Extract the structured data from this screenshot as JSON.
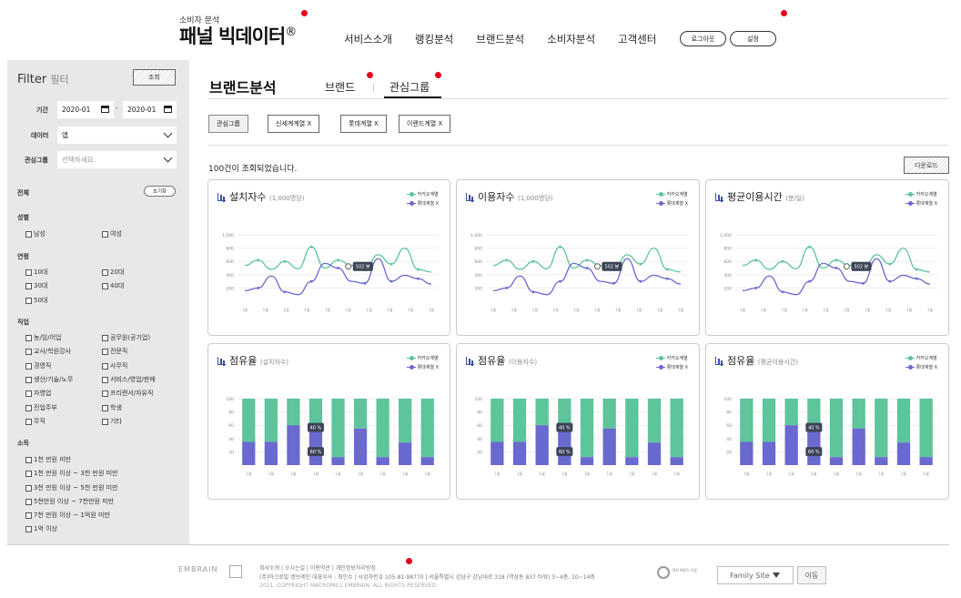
{
  "header": {
    "logo_sub": "소비자 분석",
    "logo_main": "패널 빅데이터",
    "logo_mark": "®",
    "nav": [
      "서비스소개",
      "랭킹분석",
      "브랜드분석",
      "소비자분석",
      "고객센터"
    ],
    "logout": "로그아웃",
    "settings": "설정"
  },
  "sidebar": {
    "title": "Filter",
    "title_sub": "필터",
    "query_btn": "조회",
    "period_label": "기간",
    "date_from": "2020-01",
    "date_sep": "-",
    "date_to": "2020-01",
    "data_label": "데이터",
    "data_value": "앱",
    "group_label": "관심그룹",
    "group_placeholder": "선택하세요.",
    "all_label": "전체",
    "reset_btn": "초기화",
    "gender": {
      "title": "성별",
      "options": [
        "남성",
        "여성"
      ]
    },
    "age": {
      "title": "연령",
      "options": [
        "10대",
        "20대",
        "30대",
        "40대",
        "50대"
      ]
    },
    "job": {
      "title": "직업",
      "options": [
        "농/임/어업",
        "공무원(공기업)",
        "교사/학원강사",
        "전문직",
        "경영직",
        "사무직",
        "생산/기술/노무",
        "서비스/영업/판매",
        "자영업",
        "프리랜서/자유직",
        "전업주부",
        "학생",
        "무직",
        "기타"
      ]
    },
    "income": {
      "title": "소득",
      "options": [
        "1천 만원 미만",
        "1천 만원 이상 ~ 3천 만원 미만",
        "3천 만원 이상 ~ 5천 만원 미만",
        "5천만원 이상 ~ 7천만원 미만",
        "7천 만원 이상 ~ 1억원 미만",
        "1억 이상"
      ]
    }
  },
  "main": {
    "page_title": "브랜드분석",
    "tabs": [
      "브랜드",
      "관심그룹"
    ],
    "chips": [
      "관심그룹",
      "신세계계열 X",
      "롯데계열 X",
      "이랜드계열 X"
    ],
    "result_count": "100건이 조회되었습니다.",
    "download": "다운로드",
    "legend": [
      "카카오계열",
      "롯데계열 X"
    ]
  },
  "charts": [
    {
      "title": "설치자수",
      "unit": "(1,000명당)",
      "kind": "line"
    },
    {
      "title": "이용자수",
      "unit": "(1,000명당)",
      "kind": "line"
    },
    {
      "title": "평균이용시간",
      "unit": "(분/일)",
      "kind": "line"
    },
    {
      "title": "점유율",
      "unit": "(설치자수)",
      "kind": "bar"
    },
    {
      "title": "점유율",
      "unit": "(이용자수)",
      "kind": "bar"
    },
    {
      "title": "점유율",
      "unit": "(평균이용시간)",
      "kind": "bar"
    }
  ],
  "chart_data": [
    {
      "type": "line",
      "yticks": [
        "1,000",
        "800",
        "600",
        "400",
        "200"
      ],
      "ylim": [
        0,
        1000
      ],
      "tooltip": "502 분",
      "series": [
        {
          "name": "카카오계열",
          "color": "#5dc49b",
          "values": [
            540,
            620,
            480,
            600,
            490,
            820,
            500,
            620,
            540,
            470,
            700,
            560,
            800,
            480,
            440
          ]
        },
        {
          "name": "롯데계열 X",
          "color": "#6a69cf",
          "values": [
            160,
            200,
            380,
            140,
            100,
            300,
            570,
            500,
            300,
            270,
            640,
            300,
            390,
            340,
            260
          ]
        }
      ]
    },
    {
      "type": "bar",
      "yticks": [
        "100",
        "80",
        "60",
        "40",
        "20"
      ],
      "ylim": [
        0,
        100
      ],
      "tooltips": [
        "40 %",
        "60 %"
      ],
      "series": [
        {
          "name": "카카오계열",
          "color": "#5dc49b",
          "values": [
            65,
            65,
            40,
            40,
            88,
            45,
            88,
            66,
            88
          ]
        },
        {
          "name": "롯데계열 X",
          "color": "#6a69cf",
          "values": [
            35,
            35,
            60,
            60,
            12,
            55,
            12,
            34,
            12
          ]
        }
      ]
    }
  ],
  "footer": {
    "logo": "EMBRAIN",
    "links": "회사소개 | 오시는길 | 이용약관 | 개인정보처리방침",
    "address": "(주)마크로밀 엠브레인 대표이사 : 최인수 | 사업자번호 105-81-98770 | 서울특별시 강남구 강남대로 318 (역삼동 837 타워) 3~4층, 10~14층",
    "copyright": "2021. COPYRIGHT MACROMILL EMBRAIN. ALL RIGHTS RESERVED.",
    "iso": "ISO 9001 인증",
    "family_site": "Family Site",
    "go": "이동"
  }
}
